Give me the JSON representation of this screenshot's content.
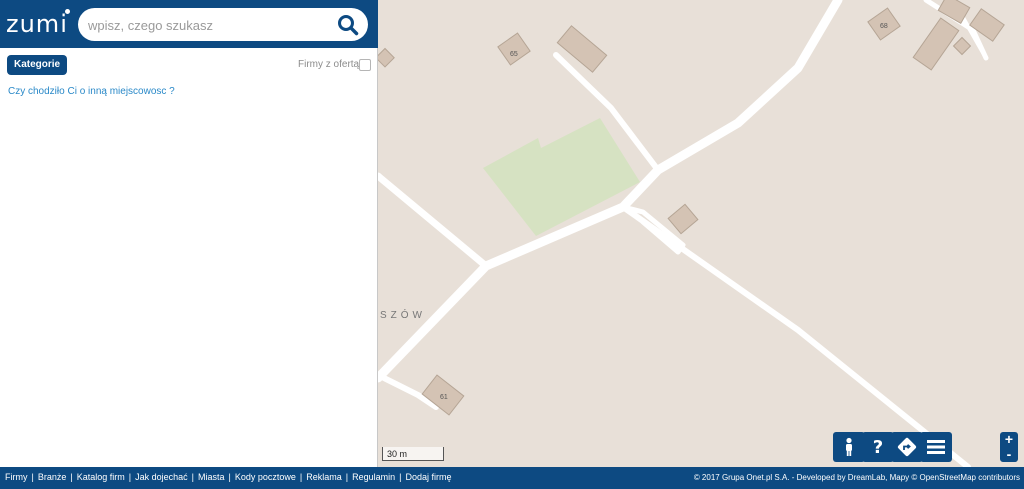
{
  "app": {
    "logo_text": "zumi"
  },
  "search": {
    "placeholder": "wpisz, czego szukasz",
    "value": "",
    "icon": "search-icon"
  },
  "filters": {
    "categories_label": "Kategorie",
    "offer_filter_label": "Firmy z ofertą",
    "offer_filter_checked": false
  },
  "results": {
    "suggestion_text": "Czy chodziło Ci o inną miejscowosc ?"
  },
  "map": {
    "place_label": "SZÓW",
    "house_numbers": [
      "65",
      "68",
      "61"
    ],
    "scale_label": "30 m",
    "controls": [
      {
        "name": "street-view",
        "icon": "person-icon"
      },
      {
        "name": "help",
        "icon": "question-icon"
      },
      {
        "name": "directions",
        "icon": "route-icon"
      },
      {
        "name": "layers",
        "icon": "menu-icon"
      }
    ],
    "zoom_in_label": "+",
    "zoom_out_label": "-",
    "colors": {
      "land": "#e8e0d8",
      "road": "#ffffff",
      "park": "#d6e2c2",
      "building": "#d4c3b4"
    }
  },
  "footer": {
    "links": [
      "Firmy",
      "Branże",
      "Katalog firm",
      "Jak dojechać",
      "Miasta",
      "Kody pocztowe",
      "Reklama",
      "Regulamin",
      "Dodaj firmę"
    ],
    "copyright": "© 2017 Grupa Onet.pl S.A. - Developed by DreamLab, Mapy © OpenStreetMap contributors"
  },
  "colors": {
    "brand": "#0d4a82",
    "link": "#2a89c8"
  }
}
